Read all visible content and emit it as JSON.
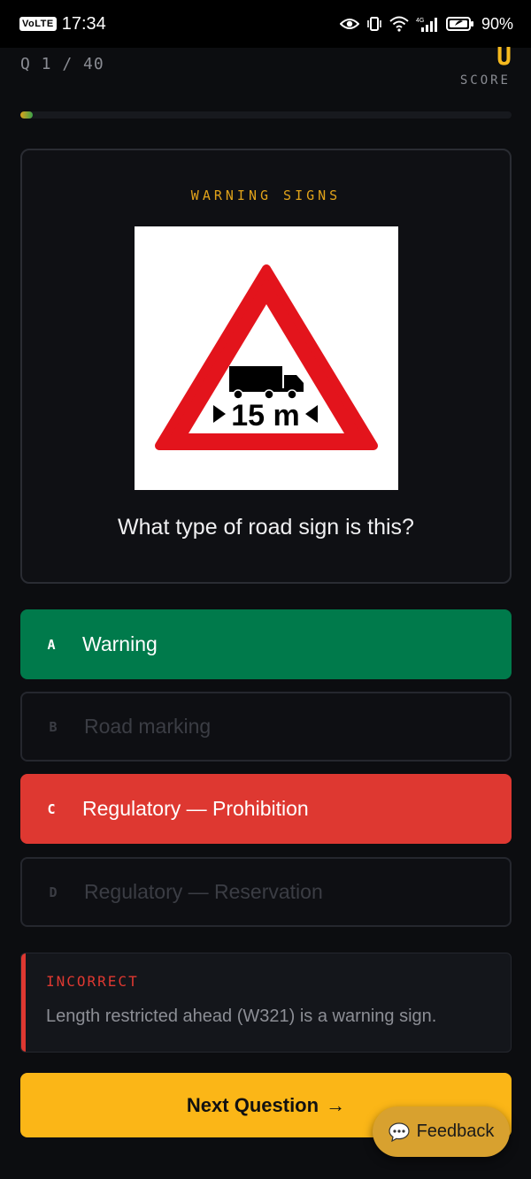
{
  "status_bar": {
    "volte": "VoLTE",
    "time": "17:34",
    "network": "4G",
    "battery": "90%"
  },
  "header": {
    "question_counter": "Q 1 / 40",
    "score_value": "U",
    "score_label": "SCORE",
    "progress": 0.025
  },
  "question_card": {
    "category": "WARNING SIGNS",
    "sign": {
      "length_text": "15 m",
      "colors": {
        "border": "#e3141c",
        "fill": "#ffffff",
        "symbol": "#000000"
      }
    },
    "question": "What type of road sign is this?"
  },
  "options": [
    {
      "letter": "A",
      "text": "Warning",
      "state": "correct"
    },
    {
      "letter": "B",
      "text": "Road marking",
      "state": "disabled"
    },
    {
      "letter": "C",
      "text": "Regulatory — Prohibition",
      "state": "wrong"
    },
    {
      "letter": "D",
      "text": "Regulatory — Reservation",
      "state": "disabled"
    }
  ],
  "feedback": {
    "title": "INCORRECT",
    "text": "Length restricted ahead (W321) is a warning sign."
  },
  "next_button": {
    "label": "Next Question",
    "arrow": "→"
  },
  "feedback_fab": {
    "label": "Feedback",
    "icon": "chat-bubble-icon"
  },
  "colors": {
    "accent": "#fbb617",
    "correct": "#007a4b",
    "wrong": "#de3831",
    "category": "#e0a21a"
  }
}
